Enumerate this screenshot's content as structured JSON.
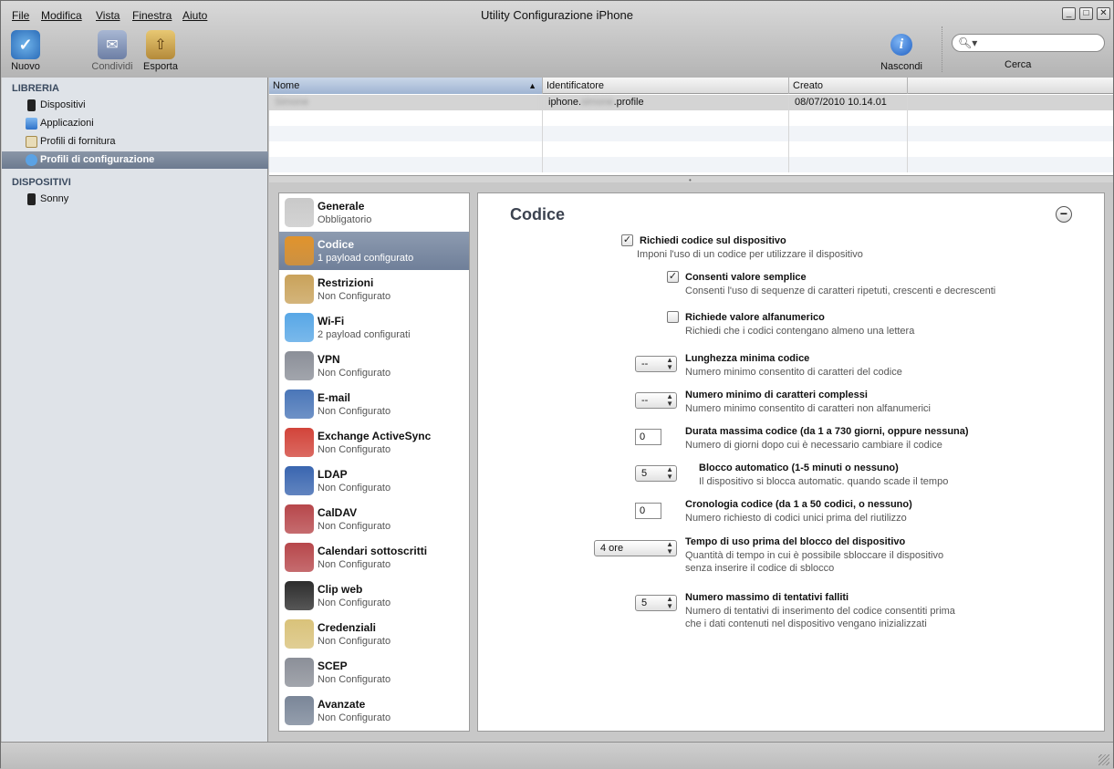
{
  "window": {
    "title": "Utility Configurazione iPhone"
  },
  "menu": [
    "File",
    "Modifica",
    "Vista",
    "Finestra",
    "Aiuto"
  ],
  "toolbar": {
    "nuovo": "Nuovo",
    "condividi": "Condividi",
    "esporta": "Esporta",
    "nascondi": "Nascondi",
    "cerca": "Cerca"
  },
  "sidebar": {
    "library_header": "LIBRERIA",
    "library_items": [
      "Dispositivi",
      "Applicazioni",
      "Profili di fornitura",
      "Profili di configurazione"
    ],
    "devices_header": "DISPOSITIVI",
    "device_items": [
      "Sonny"
    ]
  },
  "table": {
    "columns": [
      "Nome",
      "Identificatore",
      "Creato"
    ],
    "rows": [
      {
        "nome": "Simone",
        "identificatore_prefix": "iphone.",
        "identificatore_blur": "simone",
        "identificatore_suffix": ".profile",
        "creato": "08/07/2010 10.14.01"
      }
    ]
  },
  "payloads": [
    {
      "name": "Generale",
      "status": "Obbligatorio",
      "icon": "general-icon",
      "color": "#c9c9c9"
    },
    {
      "name": "Codice",
      "status": "1 payload configurato",
      "icon": "key-icon",
      "color": "#e0932c"
    },
    {
      "name": "Restrizioni",
      "status": "Non Configurato",
      "icon": "padlock-icon",
      "color": "#c9a25a"
    },
    {
      "name": "Wi-Fi",
      "status": "2 payload configurati",
      "icon": "wifi-icon",
      "color": "#58a7e6"
    },
    {
      "name": "VPN",
      "status": "Non Configurato",
      "icon": "vpn-lock-icon",
      "color": "#8b8f98"
    },
    {
      "name": "E-mail",
      "status": "Non Configurato",
      "icon": "email-icon",
      "color": "#4a76b8"
    },
    {
      "name": "Exchange ActiveSync",
      "status": "Non Configurato",
      "icon": "exchange-icon",
      "color": "#d2443a"
    },
    {
      "name": "LDAP",
      "status": "Non Configurato",
      "icon": "ldap-icon",
      "color": "#3a66b0"
    },
    {
      "name": "CalDAV",
      "status": "Non Configurato",
      "icon": "caldav-icon",
      "color": "#b7474b"
    },
    {
      "name": "Calendari sottoscritti",
      "status": "Non Configurato",
      "icon": "subscribed-calendar-icon",
      "color": "#b7474b"
    },
    {
      "name": "Clip web",
      "status": "Non Configurato",
      "icon": "webclip-icon",
      "color": "#2d2d2d"
    },
    {
      "name": "Credenziali",
      "status": "Non Configurato",
      "icon": "certificate-icon",
      "color": "#d9c27a"
    },
    {
      "name": "SCEP",
      "status": "Non Configurato",
      "icon": "scep-icon",
      "color": "#8b8f98"
    },
    {
      "name": "Avanzate",
      "status": "Non Configurato",
      "icon": "gear-icon",
      "color": "#7a8698"
    }
  ],
  "detail": {
    "title": "Codice",
    "options": {
      "richiedi": {
        "label": "Richiedi codice sul dispositivo",
        "sub": "Imponi l'uso di un codice per utilizzare il dispositivo",
        "checked": true
      },
      "semplice": {
        "label": "Consenti valore semplice",
        "sub": "Consenti l'uso di sequenze di caratteri ripetuti, crescenti e decrescenti",
        "checked": true
      },
      "alfanumerico": {
        "label": "Richiede valore alfanumerico",
        "sub": "Richiedi che i codici contengano almeno una lettera",
        "checked": false
      },
      "lunghezza": {
        "label": "Lunghezza minima codice",
        "sub": "Numero minimo consentito di caratteri del codice",
        "value": "--"
      },
      "complessi": {
        "label": "Numero minimo di caratteri complessi",
        "sub": "Numero minimo consentito di caratteri non alfanumerici",
        "value": "--"
      },
      "durata": {
        "label": "Durata massima codice (da 1 a 730 giorni, oppure nessuna)",
        "sub": "Numero di giorni dopo cui è necessario cambiare il codice",
        "value": "0"
      },
      "blocco": {
        "label": "Blocco automatico (1-5 minuti o nessuno)",
        "sub": "Il dispositivo si blocca automatic. quando scade il tempo",
        "value": "5"
      },
      "cronologia": {
        "label": "Cronologia codice (da 1 a 50 codici, o nessuno)",
        "sub": "Numero richiesto di codici unici prima del riutilizzo",
        "value": "0"
      },
      "tempo": {
        "label": "Tempo di uso prima del blocco del dispositivo",
        "sub1": "Quantità di tempo in cui è possibile sbloccare il dispositivo",
        "sub2": "senza inserire il codice di sblocco",
        "value": "4 ore"
      },
      "tentativi": {
        "label": "Numero massimo di tentativi falliti",
        "sub1": "Numero di tentativi di inserimento del codice consentiti prima",
        "sub2": "che i dati contenuti nel dispositivo vengano inizializzati",
        "value": "5"
      }
    }
  }
}
